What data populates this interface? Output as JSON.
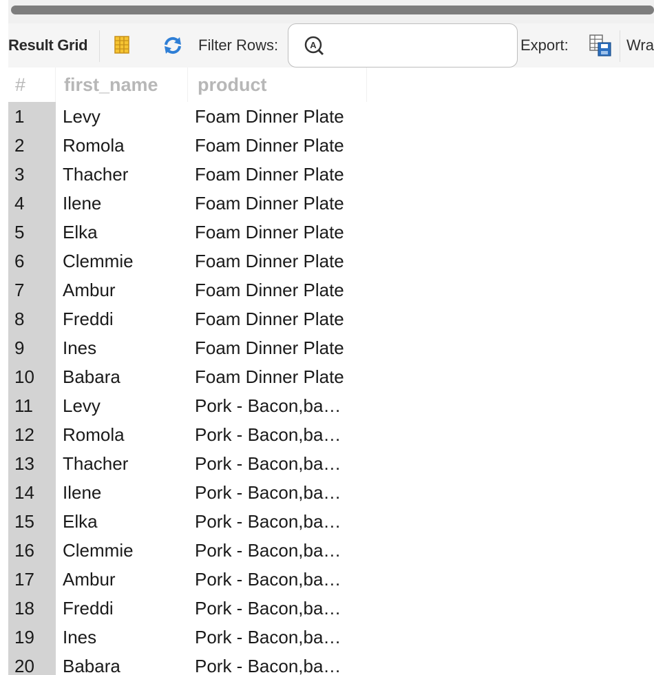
{
  "toolbar": {
    "result_grid_label": "Result Grid",
    "filter_label": "Filter Rows:",
    "filter_value": "",
    "export_label": "Export:",
    "wrap_label": "Wra",
    "icons": [
      "grid-layout-icon",
      "refresh-icon",
      "search-icon",
      "export-icon"
    ]
  },
  "grid": {
    "columns": [
      "#",
      "first_name",
      "product"
    ],
    "rows": [
      {
        "num": "1",
        "first_name": "Levy",
        "product": "Foam Dinner Plate"
      },
      {
        "num": "2",
        "first_name": "Romola",
        "product": "Foam Dinner Plate"
      },
      {
        "num": "3",
        "first_name": "Thacher",
        "product": "Foam Dinner Plate"
      },
      {
        "num": "4",
        "first_name": "Ilene",
        "product": "Foam Dinner Plate"
      },
      {
        "num": "5",
        "first_name": "Elka",
        "product": "Foam Dinner Plate"
      },
      {
        "num": "6",
        "first_name": "Clemmie",
        "product": "Foam Dinner Plate"
      },
      {
        "num": "7",
        "first_name": "Ambur",
        "product": "Foam Dinner Plate"
      },
      {
        "num": "8",
        "first_name": "Freddi",
        "product": "Foam Dinner Plate"
      },
      {
        "num": "9",
        "first_name": "Ines",
        "product": "Foam Dinner Plate"
      },
      {
        "num": "10",
        "first_name": "Babara",
        "product": "Foam Dinner Plate"
      },
      {
        "num": "11",
        "first_name": "Levy",
        "product": "Pork - Bacon,ba…"
      },
      {
        "num": "12",
        "first_name": "Romola",
        "product": "Pork - Bacon,ba…"
      },
      {
        "num": "13",
        "first_name": "Thacher",
        "product": "Pork - Bacon,ba…"
      },
      {
        "num": "14",
        "first_name": "Ilene",
        "product": "Pork - Bacon,ba…"
      },
      {
        "num": "15",
        "first_name": "Elka",
        "product": "Pork - Bacon,ba…"
      },
      {
        "num": "16",
        "first_name": "Clemmie",
        "product": "Pork - Bacon,ba…"
      },
      {
        "num": "17",
        "first_name": "Ambur",
        "product": "Pork - Bacon,ba…"
      },
      {
        "num": "18",
        "first_name": "Freddi",
        "product": "Pork - Bacon,ba…"
      },
      {
        "num": "19",
        "first_name": "Ines",
        "product": "Pork - Bacon,ba…"
      },
      {
        "num": "20",
        "first_name": "Babara",
        "product": "Pork - Bacon,ba…"
      }
    ]
  },
  "colors": {
    "row_number_bg": "#d3d3d3",
    "header_text": "#b7b7b7",
    "refresh_icon": "#2f7fd6"
  }
}
